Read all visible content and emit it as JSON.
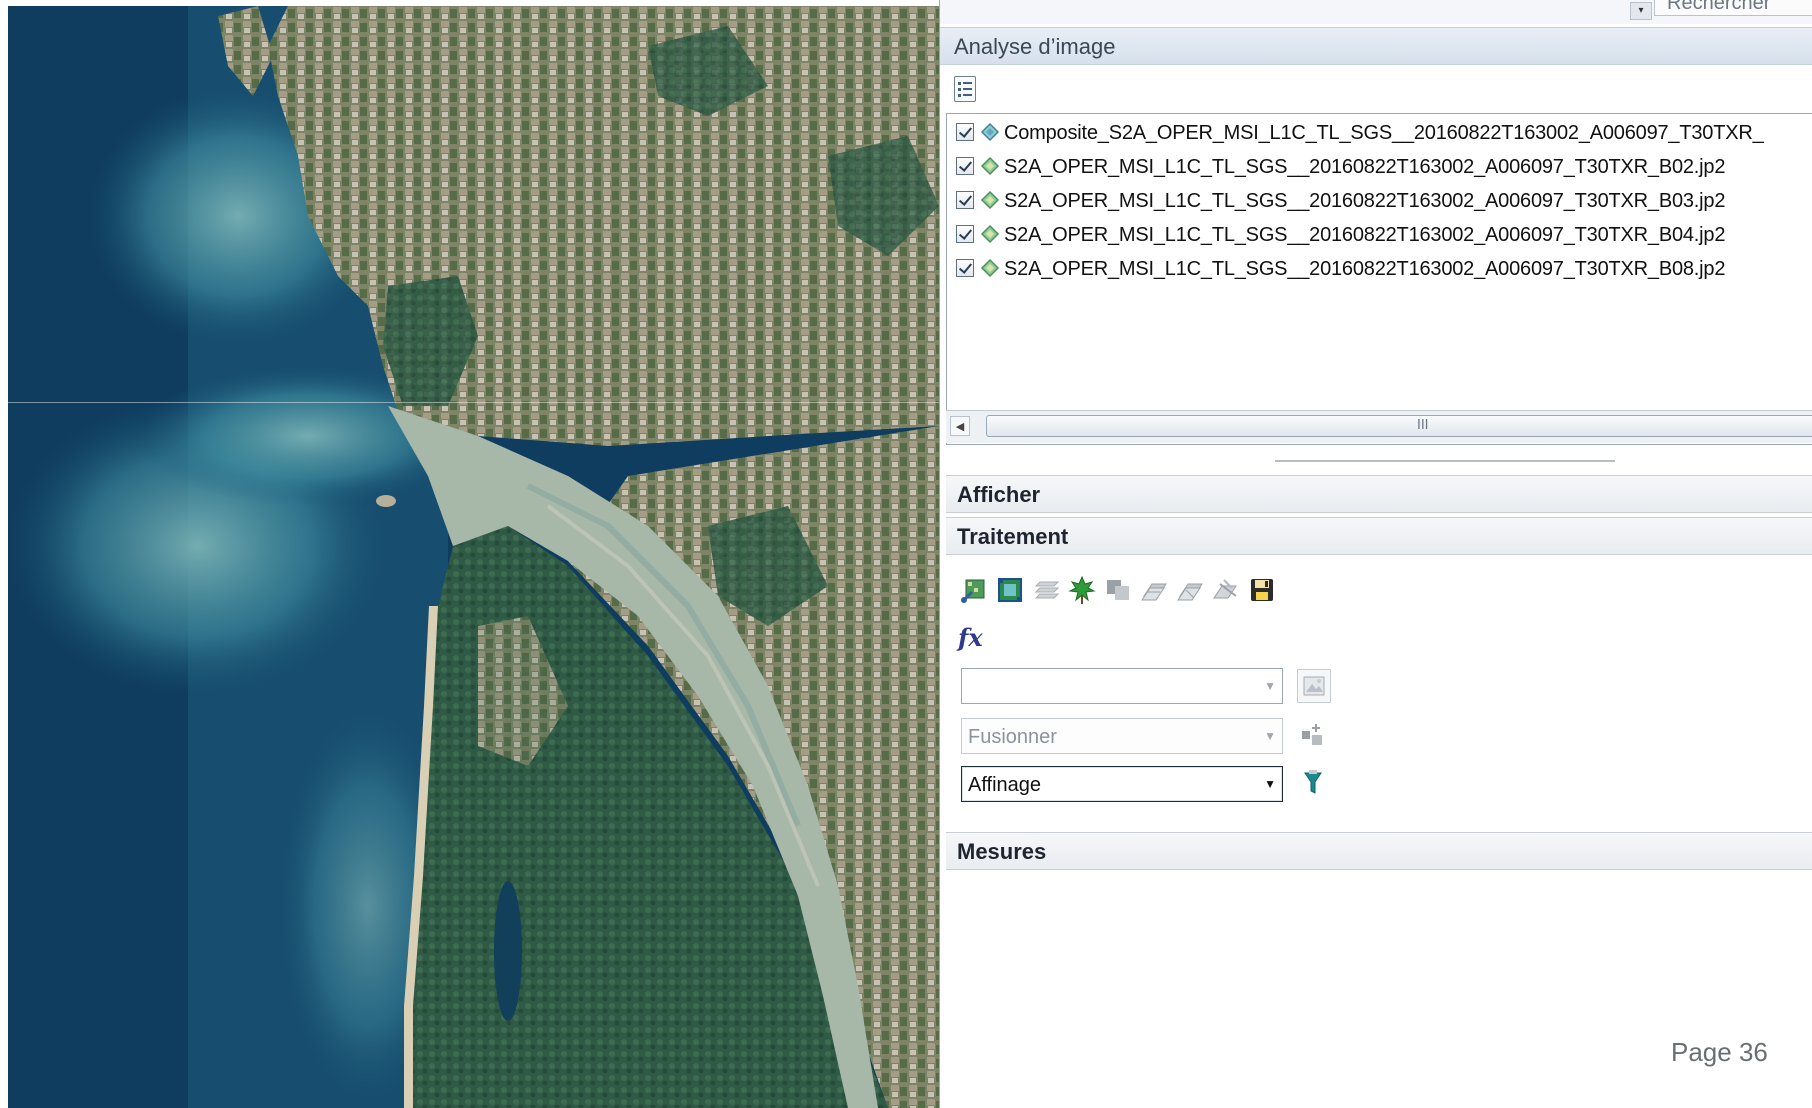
{
  "search": {
    "placeholder": "Rechercher"
  },
  "panel": {
    "title": "Analyse d’image"
  },
  "layers": [
    {
      "label": "Composite_S2A_OPER_MSI_L1C_TL_SGS__20160822T163002_A006097_T30TXR_",
      "checked": true
    },
    {
      "label": "S2A_OPER_MSI_L1C_TL_SGS__20160822T163002_A006097_T30TXR_B02.jp2",
      "checked": true
    },
    {
      "label": "S2A_OPER_MSI_L1C_TL_SGS__20160822T163002_A006097_T30TXR_B03.jp2",
      "checked": true
    },
    {
      "label": "S2A_OPER_MSI_L1C_TL_SGS__20160822T163002_A006097_T30TXR_B04.jp2",
      "checked": true
    },
    {
      "label": "S2A_OPER_MSI_L1C_TL_SGS__20160822T163002_A006097_T30TXR_B08.jp2",
      "checked": true
    }
  ],
  "scrollbar": {
    "grip": "III"
  },
  "sections": {
    "afficher": "Afficher",
    "traitement": "Traitement",
    "mesures": "Mesures"
  },
  "tools": [
    "clip-icon",
    "mask-icon",
    "layers-icon",
    "ndvi-leaf-icon",
    "pan-sharpen-icon",
    "mosaic-icon",
    "difference-icon",
    "orthorectify-icon",
    "save-icon"
  ],
  "function_button": {
    "label": "fx"
  },
  "combos": {
    "raster": {
      "value": ""
    },
    "merge": {
      "value": "Fusionner"
    },
    "refine": {
      "value": "Affinage"
    }
  },
  "footer": {
    "page": "Page 36"
  },
  "colors": {
    "ocean": "#0f3d5f",
    "panel_header": "#d6e0ec",
    "accent_filter": "#1b8a8f"
  }
}
